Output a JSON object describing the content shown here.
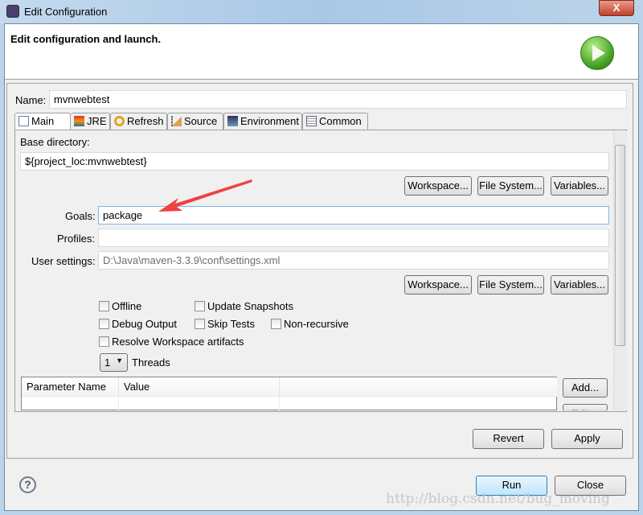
{
  "window": {
    "title": "Edit Configuration",
    "close_label": "X"
  },
  "header": {
    "text": "Edit configuration and launch.",
    "logo_icon": "run-play-icon"
  },
  "name": {
    "label": "Name:",
    "value": "mvnwebtest"
  },
  "tabs": [
    {
      "label": "Main",
      "icon": "main-tab-icon",
      "active": true
    },
    {
      "label": "JRE",
      "icon": "jre-icon"
    },
    {
      "label": "Refresh",
      "icon": "refresh-icon"
    },
    {
      "label": "Source",
      "icon": "source-icon"
    },
    {
      "label": "Environment",
      "icon": "environment-icon"
    },
    {
      "label": "Common",
      "icon": "common-icon"
    }
  ],
  "main": {
    "base_dir_label": "Base directory:",
    "base_dir_value": "${project_loc:mvnwebtest}",
    "workspace_btn": "Workspace...",
    "filesystem_btn": "File System...",
    "variables_btn": "Variables...",
    "goals_label": "Goals:",
    "goals_value": "package",
    "profiles_label": "Profiles:",
    "profiles_value": "",
    "user_settings_label": "User settings:",
    "user_settings_value": "D:\\Java\\maven-3.3.9\\conf\\settings.xml",
    "checkboxes": [
      {
        "label": "Offline",
        "checked": false
      },
      {
        "label": "Update Snapshots",
        "checked": false
      },
      {
        "label": "Debug Output",
        "checked": false
      },
      {
        "label": "Skip Tests",
        "checked": false
      },
      {
        "label": "Non-recursive",
        "checked": false
      },
      {
        "label": "Resolve Workspace artifacts",
        "checked": false
      }
    ],
    "threads_value": "1",
    "threads_label": "Threads",
    "table_headers": [
      "Parameter Name",
      "Value"
    ],
    "add_btn": "Add...",
    "edit_btn": "Edit..."
  },
  "footer": {
    "revert": "Revert",
    "apply": "Apply",
    "run": "Run",
    "close": "Close",
    "help_icon": "?"
  },
  "watermark": "http://blog.csdn.net/bug_moving",
  "colors": {
    "arrow": "#f04040",
    "focus": "#7eb4ea"
  }
}
